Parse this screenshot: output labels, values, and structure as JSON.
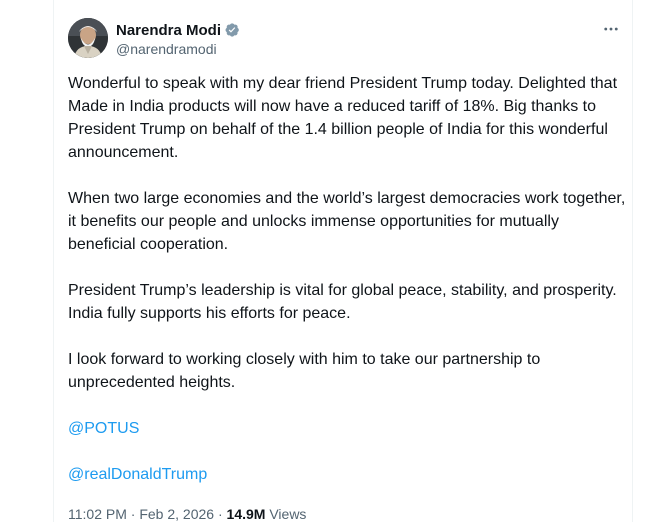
{
  "author": {
    "display_name": "Narendra Modi",
    "handle": "@narendramodi",
    "verified_icon": "verified-badge-icon",
    "avatar": "avatar"
  },
  "menu": {
    "more_icon": "more-horizontal-icon"
  },
  "tweet": {
    "paragraphs": [
      "Wonderful to speak with my dear friend President Trump today. Delighted that Made in India products will now have a reduced tariff of 18%. Big thanks to President Trump on behalf of the 1.4 billion people of India for this wonderful announcement.",
      "When two large economies and the world’s largest democracies work together, it benefits our people and unlocks immense opportunities for mutually beneficial cooperation.",
      "President Trump’s leadership is vital for global peace, stability, and prosperity. India fully supports his efforts for peace.",
      "I look forward to working closely with him to take our partnership to unprecedented heights."
    ],
    "mentions": [
      "@POTUS",
      "@realDonaldTrump"
    ]
  },
  "meta": {
    "time": "11:02 PM",
    "separator": "·",
    "date": "Feb 2, 2026",
    "views_count": "14.9M",
    "views_label": "Views"
  },
  "colors": {
    "link": "#1d9bf0",
    "secondary_text": "#536471",
    "primary_text": "#0f1419"
  }
}
